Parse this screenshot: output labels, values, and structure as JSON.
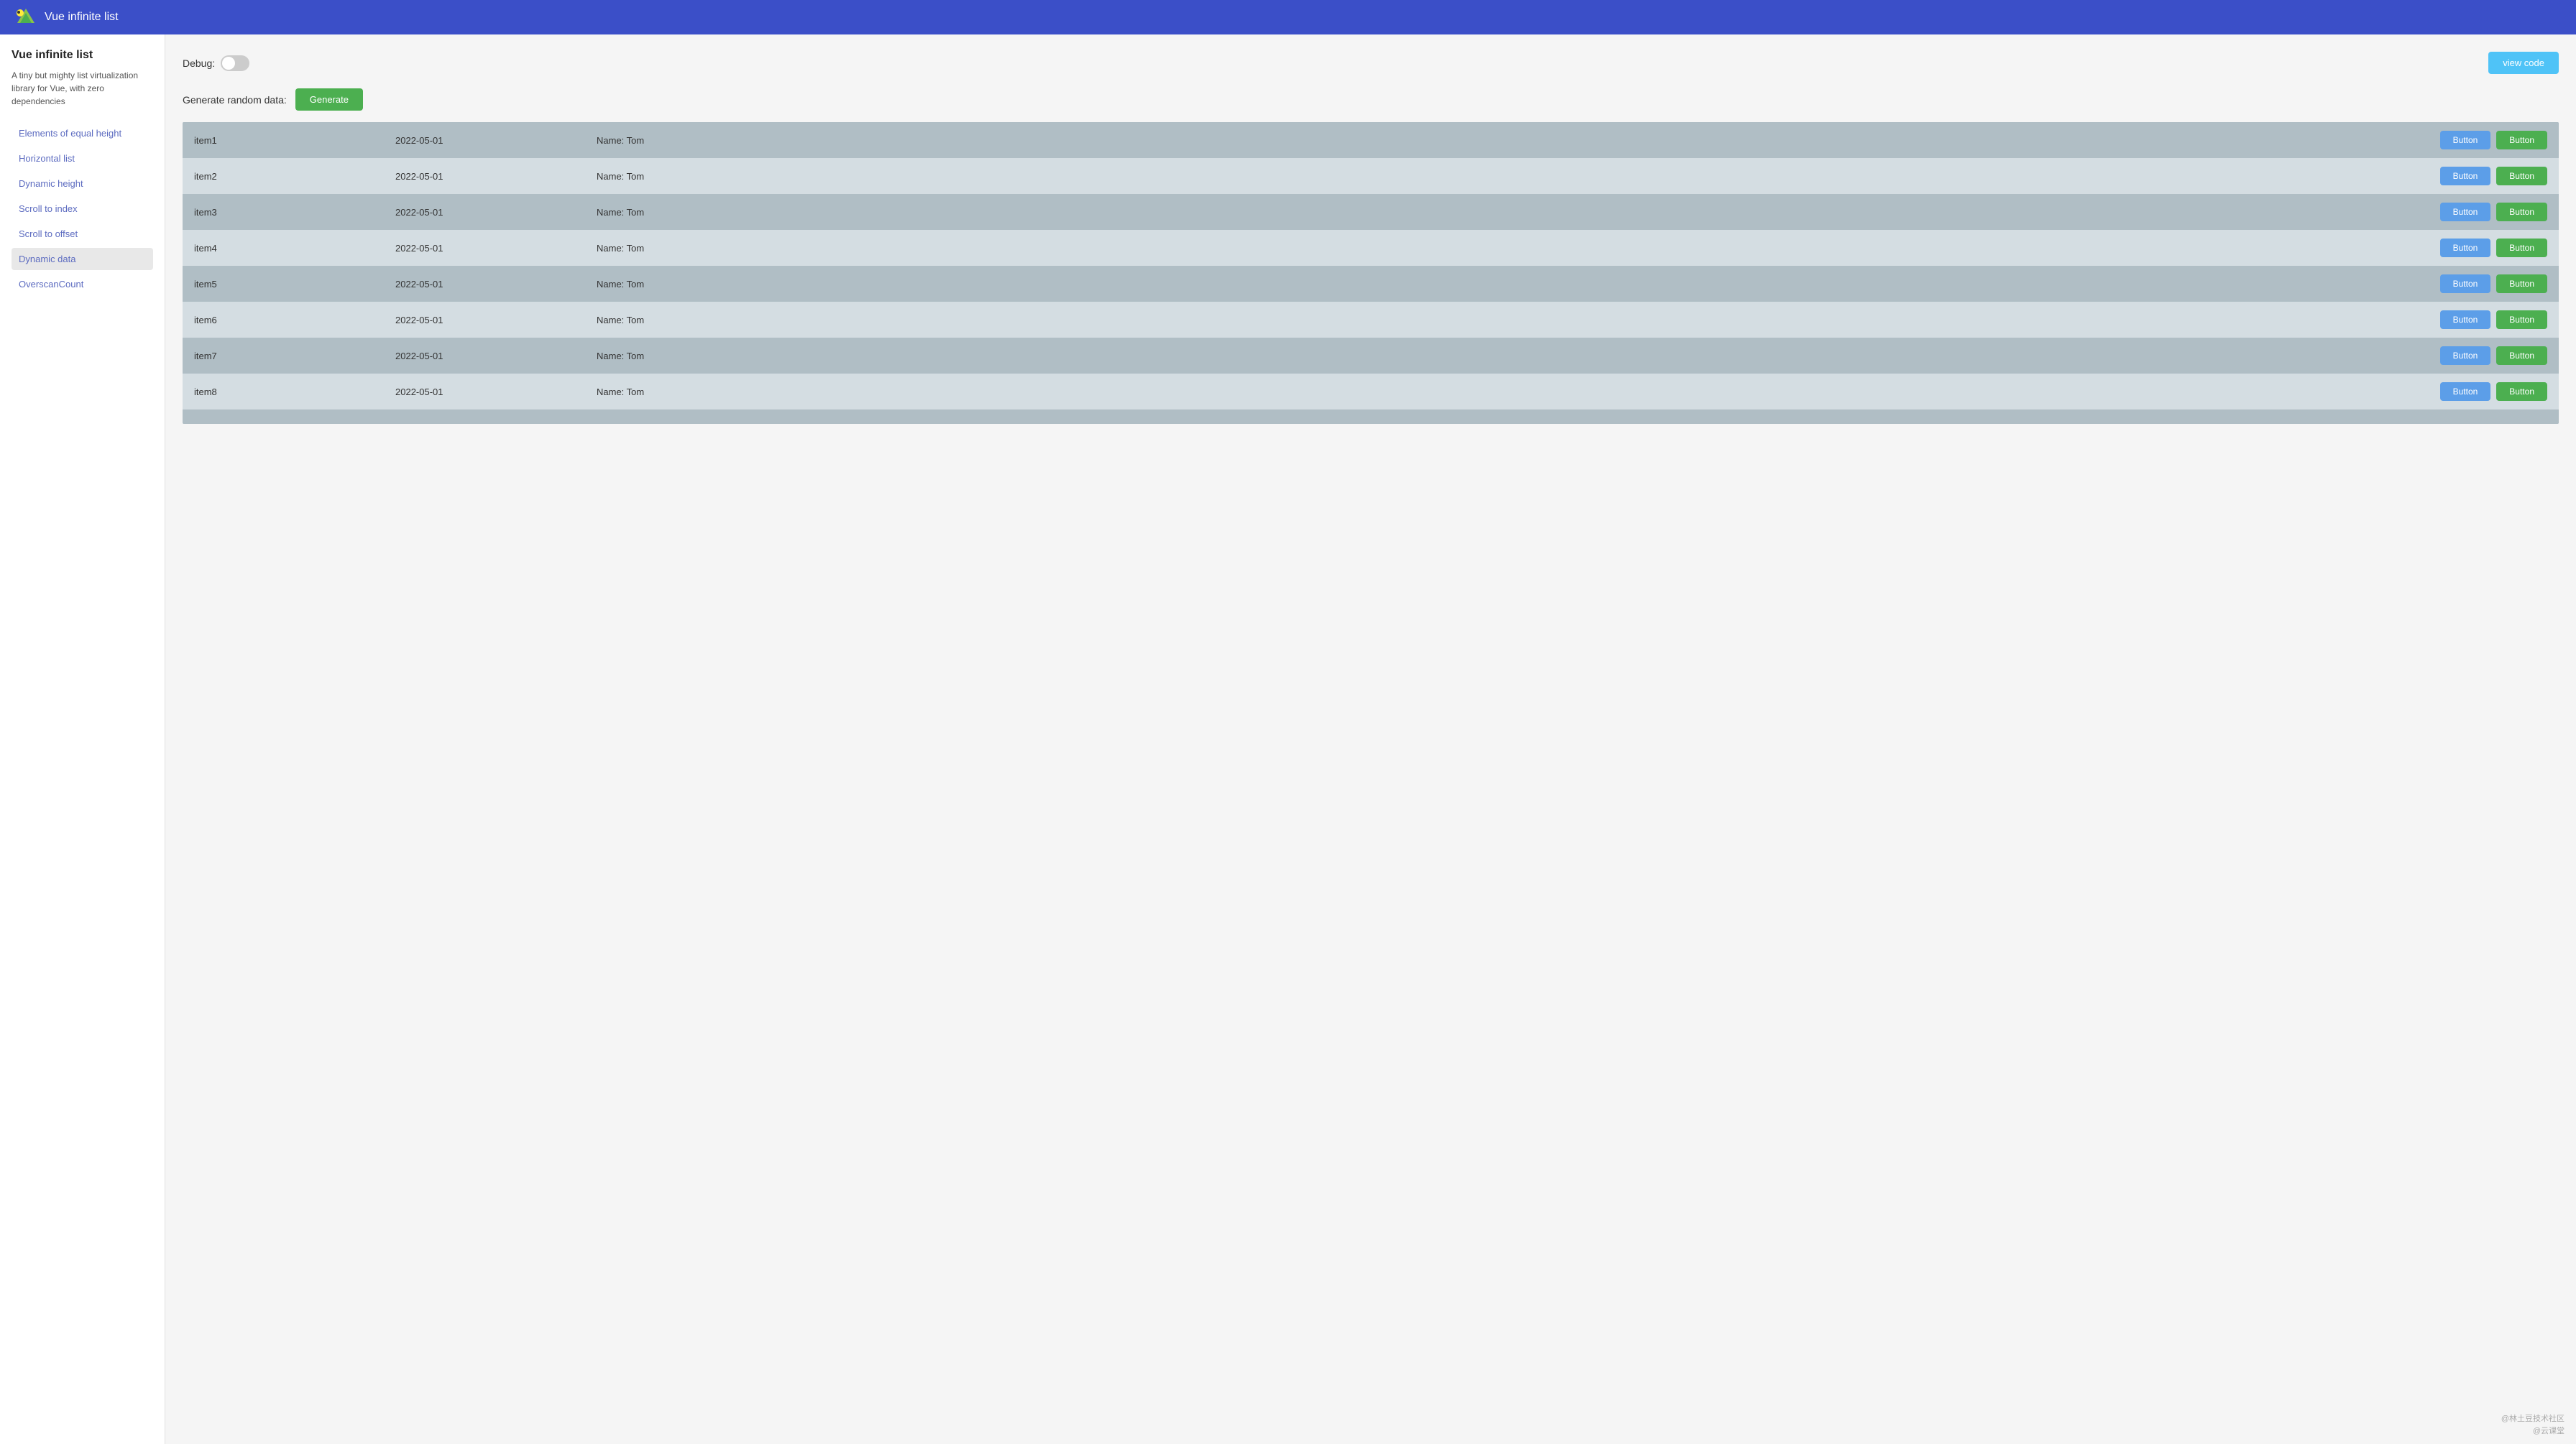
{
  "topbar": {
    "title": "Vue infinite list"
  },
  "sidebar": {
    "heading": "Vue infinite list",
    "description": "A tiny but mighty list virtualization library for Vue, with zero dependencies",
    "nav": [
      {
        "id": "elements-equal-height",
        "label": "Elements of equal height",
        "active": false
      },
      {
        "id": "horizontal-list",
        "label": "Horizontal list",
        "active": false
      },
      {
        "id": "dynamic-height",
        "label": "Dynamic height",
        "active": false
      },
      {
        "id": "scroll-to-index",
        "label": "Scroll to index",
        "active": false
      },
      {
        "id": "scroll-to-offset",
        "label": "Scroll to offset",
        "active": false
      },
      {
        "id": "dynamic-data",
        "label": "Dynamic data",
        "active": true
      },
      {
        "id": "overscan-count",
        "label": "OverscanCount",
        "active": false
      }
    ]
  },
  "main": {
    "debug_label": "Debug:",
    "debug_on": false,
    "generate_label": "Generate random data:",
    "generate_btn": "Generate",
    "view_code_btn": "view code",
    "list_rows": [
      {
        "name": "item1",
        "date": "2022-05-01",
        "label": "Name: Tom"
      },
      {
        "name": "item2",
        "date": "2022-05-01",
        "label": "Name: Tom"
      },
      {
        "name": "item3",
        "date": "2022-05-01",
        "label": "Name: Tom"
      },
      {
        "name": "item4",
        "date": "2022-05-01",
        "label": "Name: Tom"
      },
      {
        "name": "item5",
        "date": "2022-05-01",
        "label": "Name: Tom"
      },
      {
        "name": "item6",
        "date": "2022-05-01",
        "label": "Name: Tom"
      },
      {
        "name": "item7",
        "date": "2022-05-01",
        "label": "Name: Tom"
      },
      {
        "name": "item8",
        "date": "2022-05-01",
        "label": "Name: Tom"
      }
    ],
    "btn_blue_label": "Button",
    "btn_green_label": "Button"
  },
  "footer": {
    "line1": "@林土豆技术社区",
    "line2": "@云课堂"
  }
}
